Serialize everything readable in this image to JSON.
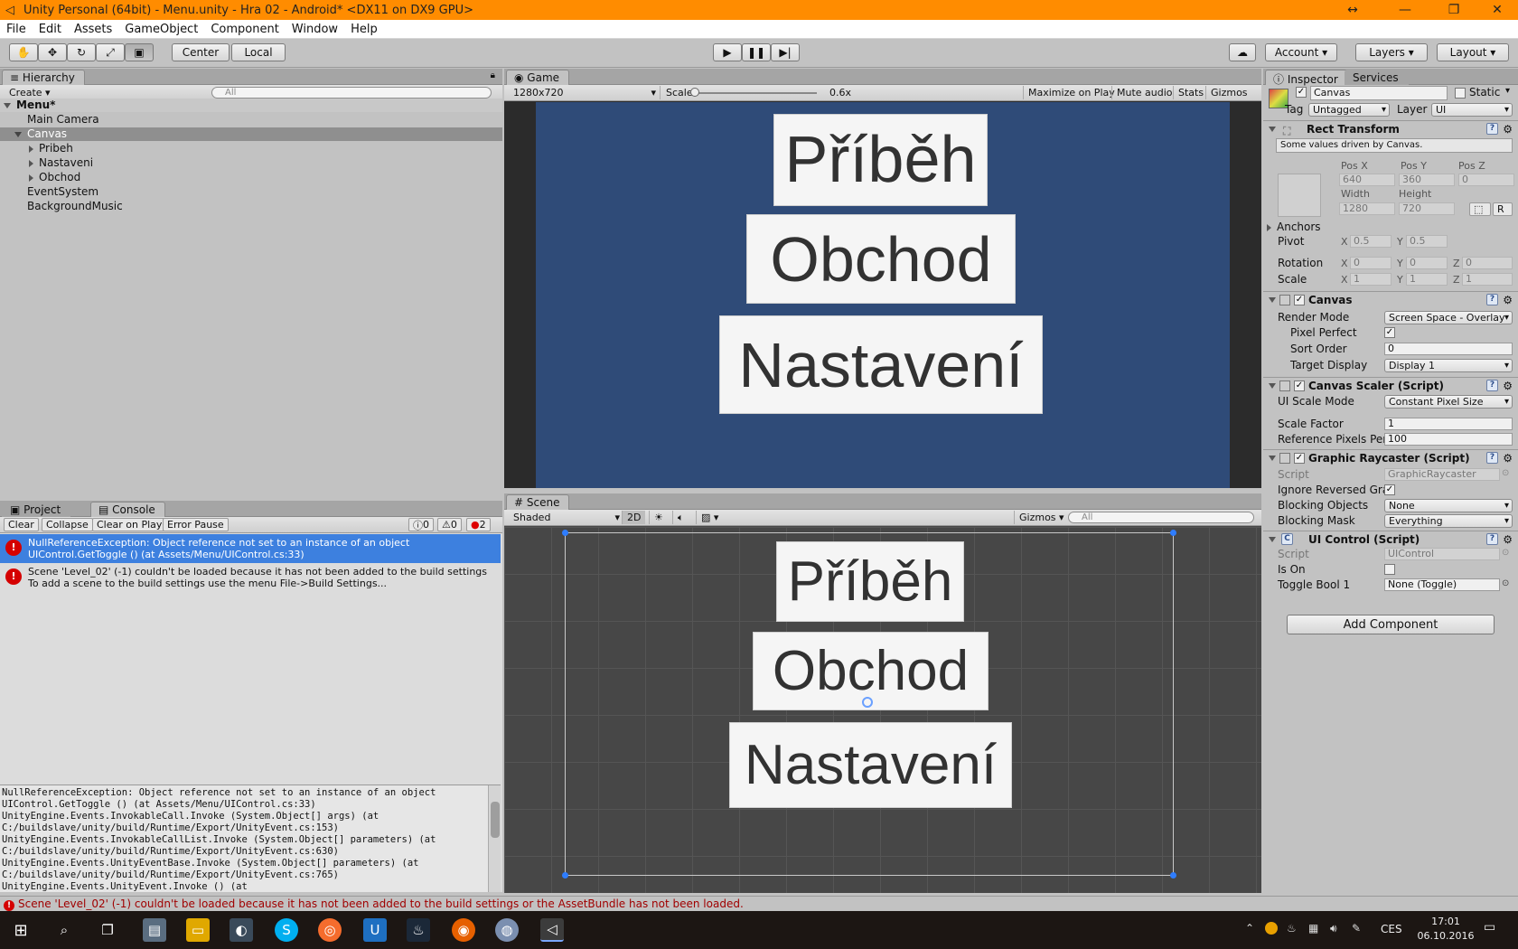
{
  "window": {
    "title": "Unity Personal (64bit) - Menu.unity - Hra 02 - Android* <DX11 on DX9 GPU>",
    "controls": [
      "↔",
      "—",
      "❐",
      "✕"
    ]
  },
  "menu": [
    "File",
    "Edit",
    "Assets",
    "GameObject",
    "Component",
    "Window",
    "Help"
  ],
  "toolbar": {
    "pivot": "Center",
    "space": "Local",
    "account": "Account",
    "layers": "Layers",
    "layout": "Layout"
  },
  "hierarchy": {
    "tab": "Hierarchy",
    "create": "Create",
    "search_placeholder": "All",
    "scene": "Menu*",
    "items": [
      {
        "label": "Main Camera"
      },
      {
        "label": "Canvas"
      },
      {
        "label": "Pribeh"
      },
      {
        "label": "Nastaveni"
      },
      {
        "label": "Obchod"
      },
      {
        "label": "EventSystem"
      },
      {
        "label": "BackgroundMusic"
      }
    ]
  },
  "console": {
    "tabs": [
      "Project",
      "Console"
    ],
    "buttons": [
      "Clear",
      "Collapse",
      "Clear on Play",
      "Error Pause"
    ],
    "counts": {
      "info": "0",
      "warn": "0",
      "error": "2"
    },
    "messages": [
      {
        "line1": "NullReferenceException: Object reference not set to an instance of an object",
        "line2": "UIControl.GetToggle () (at Assets/Menu/UIControl.cs:33)"
      },
      {
        "line1": "Scene 'Level_02' (-1) couldn't be loaded because it has not been added to the build settings",
        "line2": "To add a scene to the build settings use the menu File->Build Settings..."
      }
    ],
    "stack": [
      "NullReferenceException: Object reference not set to an instance of an object",
      "UIControl.GetToggle () (at Assets/Menu/UIControl.cs:33)",
      "UnityEngine.Events.InvokableCall.Invoke (System.Object[] args) (at",
      "C:/buildslave/unity/build/Runtime/Export/UnityEvent.cs:153)",
      "UnityEngine.Events.InvokableCallList.Invoke (System.Object[] parameters) (at",
      "C:/buildslave/unity/build/Runtime/Export/UnityEvent.cs:630)",
      "UnityEngine.Events.UnityEventBase.Invoke (System.Object[] parameters) (at",
      "C:/buildslave/unity/build/Runtime/Export/UnityEvent.cs:765)",
      "UnityEngine.Events.UnityEvent.Invoke () (at"
    ]
  },
  "game": {
    "tab": "Game",
    "resolution": "1280x720",
    "scale_label": "Scale",
    "scale_value": "0.6x",
    "scale_fraction": 0.0,
    "buttons": [
      "Maximize on Play",
      "Mute audio",
      "Stats",
      "Gizmos"
    ],
    "menu_buttons": [
      "Příběh",
      "Obchod",
      "Nastavení"
    ]
  },
  "scene": {
    "tab": "Scene",
    "shading": "Shaded",
    "mode2d": "2D",
    "gizmos": "Gizmos",
    "search_placeholder": "All",
    "menu_buttons": [
      "Příběh",
      "Obchod",
      "Nastavení"
    ]
  },
  "inspector": {
    "tabs": [
      "Inspector",
      "Services"
    ],
    "name": "Canvas",
    "static": "Static",
    "tag_label": "Tag",
    "tag": "Untagged",
    "layer_label": "Layer",
    "layer": "UI",
    "rect": {
      "title": "Rect Transform",
      "note": "Some values driven by Canvas.",
      "posx_l": "Pos X",
      "posy_l": "Pos Y",
      "posz_l": "Pos Z",
      "posx": "640",
      "posy": "360",
      "posz": "0",
      "width_l": "Width",
      "height_l": "Height",
      "width": "1280",
      "height": "720",
      "r": "R",
      "anchors": "Anchors",
      "pivot": "Pivot",
      "rotation": "Rotation",
      "scale": "Scale",
      "x": "X",
      "y": "Y",
      "z": "Z",
      "pivot_x": "0.5",
      "pivot_y": "0.5",
      "rot_x": "0",
      "rot_y": "0",
      "rot_z": "0",
      "sc_x": "1",
      "sc_y": "1",
      "sc_z": "1"
    },
    "canvas": {
      "title": "Canvas",
      "render_mode_l": "Render Mode",
      "render_mode": "Screen Space - Overlay",
      "pixel_perfect_l": "Pixel Perfect",
      "sort_order_l": "Sort Order",
      "sort_order": "0",
      "target_display_l": "Target Display",
      "target_display": "Display 1"
    },
    "scaler": {
      "title": "Canvas Scaler (Script)",
      "mode_l": "UI Scale Mode",
      "mode": "Constant Pixel Size",
      "factor_l": "Scale Factor",
      "factor": "1",
      "ref_l": "Reference Pixels Per",
      "ref": "100"
    },
    "raycaster": {
      "title": "Graphic Raycaster (Script)",
      "script_l": "Script",
      "script": "GraphicRaycaster",
      "ignore_l": "Ignore Reversed Gra",
      "blocking_l": "Blocking Objects",
      "blocking": "None",
      "mask_l": "Blocking Mask",
      "mask": "Everything"
    },
    "uicontrol": {
      "title": "UI Control (Script)",
      "script_l": "Script",
      "script": "UIControl",
      "ison_l": "Is On",
      "toggle_l": "Toggle Bool 1",
      "toggle": "None (Toggle)"
    },
    "add_component": "Add Component"
  },
  "statusbar": "Scene 'Level_02' (-1) couldn't be loaded because it has not been added to the build settings or the AssetBundle has not been loaded.",
  "taskbar": {
    "lang": "CES",
    "time": "17:01",
    "date": "06.10.2016"
  }
}
